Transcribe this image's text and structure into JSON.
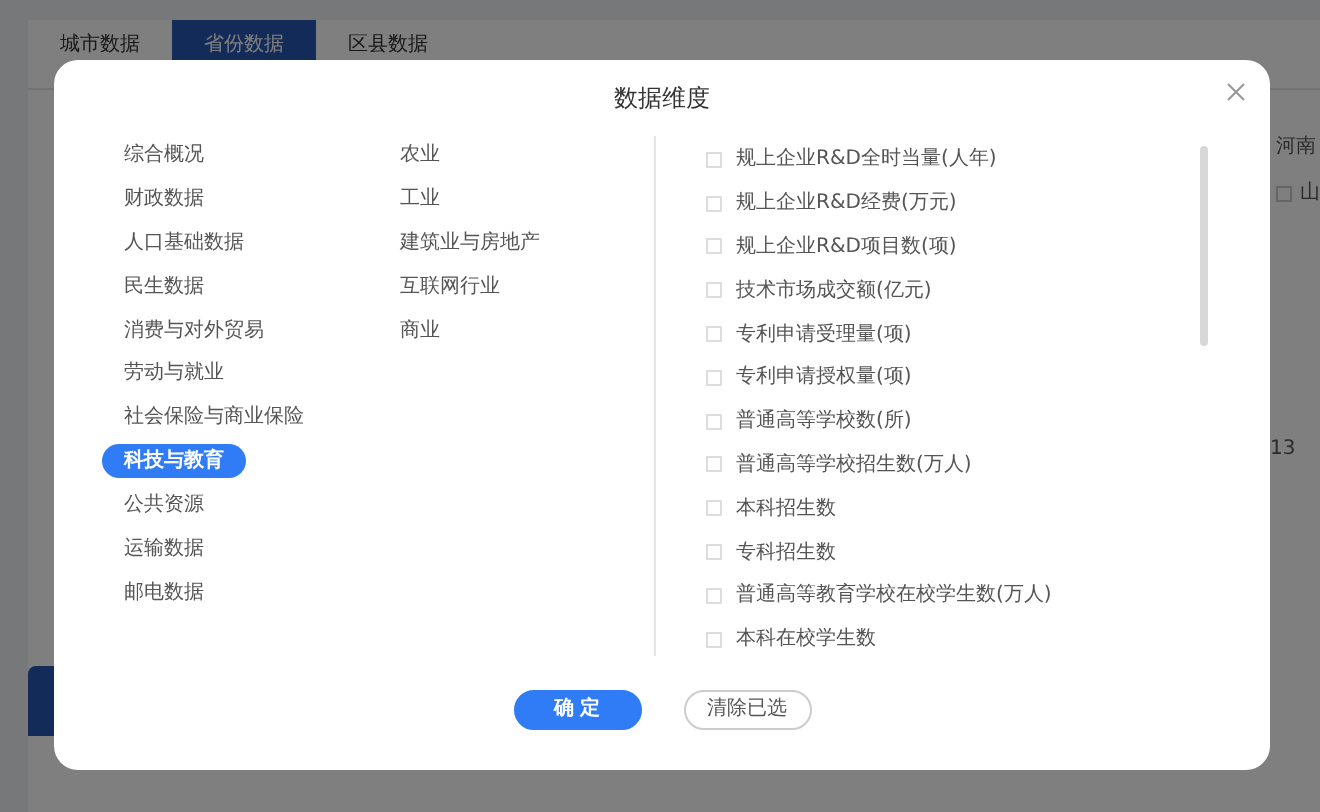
{
  "background": {
    "tabs": [
      {
        "label": "城市数据",
        "selected": false
      },
      {
        "label": "省份数据",
        "selected": true
      },
      {
        "label": "区县数据",
        "selected": false
      }
    ],
    "region_label": "河南",
    "option": {
      "label": "山",
      "checked": false
    },
    "number": "13"
  },
  "dialog": {
    "title": "数据维度",
    "category_columns": [
      [
        {
          "label": "综合概况",
          "selected": false
        },
        {
          "label": "财政数据",
          "selected": false
        },
        {
          "label": "人口基础数据",
          "selected": false
        },
        {
          "label": "民生数据",
          "selected": false
        },
        {
          "label": "消费与对外贸易",
          "selected": false
        },
        {
          "label": "劳动与就业",
          "selected": false
        },
        {
          "label": "社会保险与商业保险",
          "selected": false
        },
        {
          "label": "科技与教育",
          "selected": true
        },
        {
          "label": "公共资源",
          "selected": false
        },
        {
          "label": "运输数据",
          "selected": false
        },
        {
          "label": "邮电数据",
          "selected": false
        }
      ],
      [
        {
          "label": "农业",
          "selected": false
        },
        {
          "label": "工业",
          "selected": false
        },
        {
          "label": "建筑业与房地产",
          "selected": false
        },
        {
          "label": "互联网行业",
          "selected": false
        },
        {
          "label": "商业",
          "selected": false
        }
      ]
    ],
    "indicators": [
      {
        "label": "规上企业R&D全时当量(人年)",
        "checked": false
      },
      {
        "label": "规上企业R&D经费(万元)",
        "checked": false
      },
      {
        "label": "规上企业R&D项目数(项)",
        "checked": false
      },
      {
        "label": "技术市场成交额(亿元)",
        "checked": false
      },
      {
        "label": "专利申请受理量(项)",
        "checked": false
      },
      {
        "label": "专利申请授权量(项)",
        "checked": false
      },
      {
        "label": "普通高等学校数(所)",
        "checked": false
      },
      {
        "label": "普通高等学校招生数(万人)",
        "checked": false
      },
      {
        "label": "本科招生数",
        "checked": false
      },
      {
        "label": "专科招生数",
        "checked": false
      },
      {
        "label": "普通高等教育学校在校学生数(万人)",
        "checked": false
      },
      {
        "label": "本科在校学生数",
        "checked": false
      }
    ],
    "buttons": [
      {
        "label": "确 定",
        "kind": "primary"
      },
      {
        "label": "清除已选",
        "kind": "secondary"
      }
    ]
  }
}
